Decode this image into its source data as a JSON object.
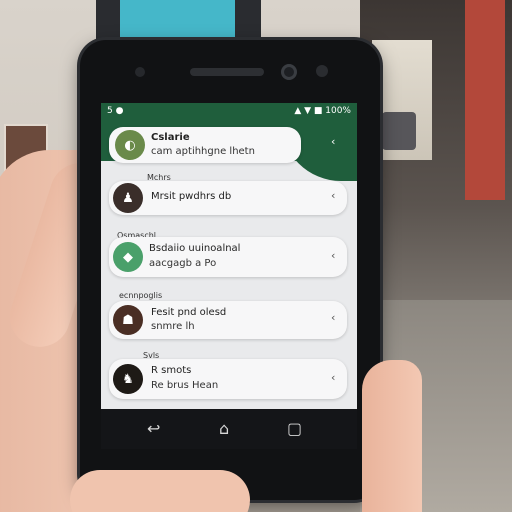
{
  "status": {
    "left": "5 ●",
    "right": "▲ ▼ ■ 100%"
  },
  "cards": [
    {
      "sender": "",
      "title": "Cslarie",
      "body": "cam aptihhgne lhetn",
      "chevron": "‹"
    },
    {
      "sender": "Mchrs",
      "title": "Mrsit pwdhrs db",
      "body": "",
      "chevron": "‹"
    },
    {
      "sender": "Osmaschl",
      "title": "Bsdaiio uuinoalnal",
      "body": "aacgagb a Po",
      "chevron": "‹"
    },
    {
      "sender": "ecnnpoglis",
      "title": "Fesit pnd olesd",
      "body": "snmre lh",
      "chevron": "‹"
    },
    {
      "sender": "Svls",
      "title": "R smots",
      "body": "Re brus Hean",
      "chevron": "‹"
    }
  ],
  "nav": {
    "back": "↩",
    "home": "⌂",
    "recents": "▢"
  },
  "colors": {
    "header": "#1f5e3c",
    "card": "#f7f7f8",
    "phone": "#111214"
  }
}
